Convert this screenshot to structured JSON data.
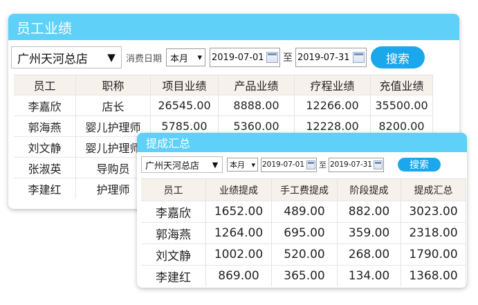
{
  "back_panel": {
    "title": "员工业绩",
    "store": "广州天河总店",
    "arrow": "▼",
    "date_type_label": "消费日期",
    "month_option": "本月",
    "month_arrow": "▾",
    "start_date": "2019-07-01",
    "to_label": "至",
    "end_date": "2019-07-31",
    "search_label": "搜索",
    "columns": [
      "员工",
      "职称",
      "项目业绩",
      "产品业绩",
      "疗程业绩",
      "充值业绩"
    ],
    "rows": [
      {
        "name": "李嘉欣",
        "title": "店长",
        "project": "26545.00",
        "product": "8888.00",
        "course": "12266.00",
        "recharge": "35500.00"
      },
      {
        "name": "郭海燕",
        "title": "婴儿护理师",
        "project": "5785.00",
        "product": "5360.00",
        "course": "12228.00",
        "recharge": "8200.00"
      },
      {
        "name": "刘文静",
        "title": "婴儿护理师",
        "project": "",
        "product": "",
        "course": "",
        "recharge": ""
      },
      {
        "name": "张淑英",
        "title": "导购员",
        "project": "",
        "product": "",
        "course": "",
        "recharge": ""
      },
      {
        "name": "李建红",
        "title": "护理师",
        "project": "",
        "product": "",
        "course": "",
        "recharge": ""
      }
    ]
  },
  "front_panel": {
    "title": "提成汇总",
    "store": "广州天河总店",
    "arrow": "▼",
    "month_option": "本月",
    "month_arrow": "▾",
    "start_date": "2019-07-01",
    "to_label": "至",
    "end_date": "2019-07-31",
    "search_label": "搜索",
    "columns": [
      "员工",
      "业绩提成",
      "手工费提成",
      "阶段提成",
      "提成汇总"
    ],
    "rows": [
      {
        "name": "李嘉欣",
        "perf": "1652.00",
        "labor": "489.00",
        "stage": "882.00",
        "total": "3023.00"
      },
      {
        "name": "郭海燕",
        "perf": "1264.00",
        "labor": "695.00",
        "stage": "359.00",
        "total": "2318.00"
      },
      {
        "name": "刘文静",
        "perf": "1002.00",
        "labor": "520.00",
        "stage": "268.00",
        "total": "1790.00"
      },
      {
        "name": "李建红",
        "perf": "869.00",
        "labor": "365.00",
        "stage": "134.00",
        "total": "1368.00"
      }
    ]
  }
}
